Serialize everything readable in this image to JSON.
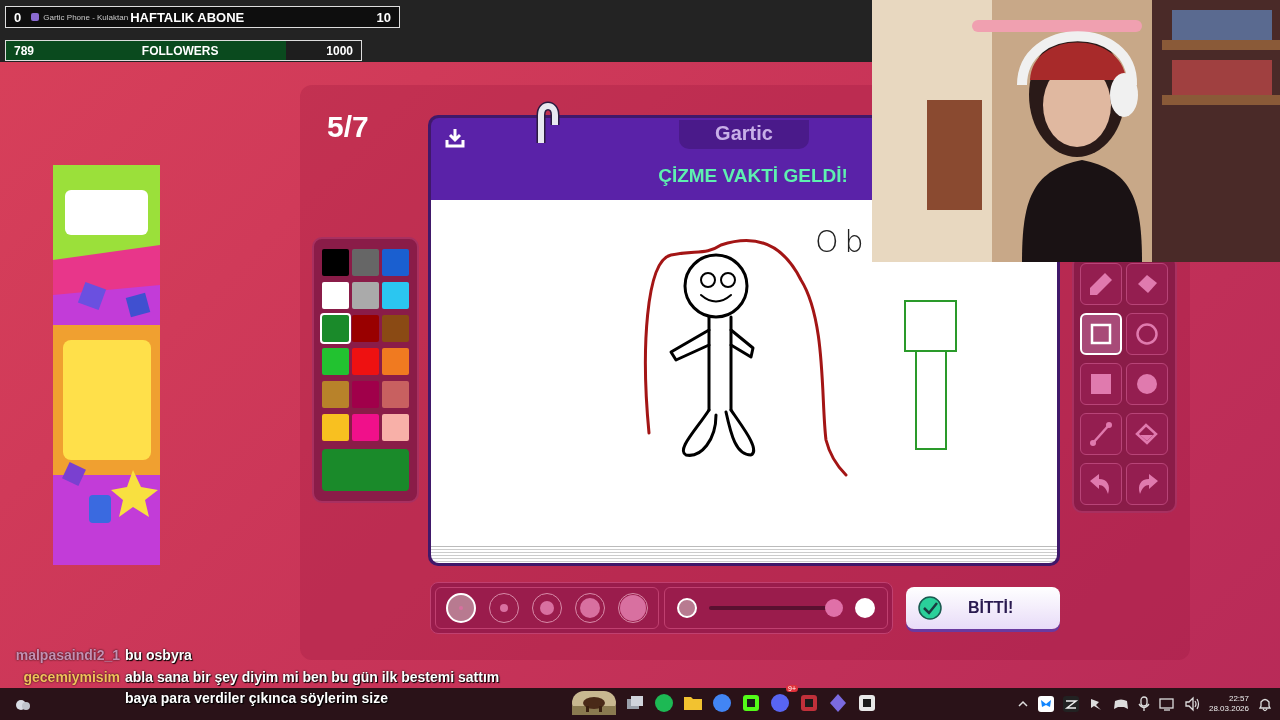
{
  "browser_tab": {
    "title": "Gartic Phone - Kulaktan"
  },
  "stream_overlay": {
    "subs_goal": {
      "current": "0",
      "title": "HAFTALIK ABONE",
      "target": "10"
    },
    "followers_goal": {
      "current": "789",
      "title": "FOLLOWERS",
      "target": "1000",
      "level": 0.789
    }
  },
  "game": {
    "round": "5/7",
    "logo": "Gartic",
    "heading": "ÇİZME VAKTİ GELDİ!",
    "canvas_text": "Ob",
    "palette": [
      {
        "color": "#000000",
        "selected": false
      },
      {
        "color": "#666666",
        "selected": false
      },
      {
        "color": "#1a5fd0",
        "selected": false
      },
      {
        "color": "#ffffff",
        "selected": false
      },
      {
        "color": "#aaaaaa",
        "selected": false
      },
      {
        "color": "#2bc6f0",
        "selected": false
      },
      {
        "color": "#1a8a2a",
        "selected": true
      },
      {
        "color": "#990000",
        "selected": false
      },
      {
        "color": "#8a4a14",
        "selected": false
      },
      {
        "color": "#22c230",
        "selected": false
      },
      {
        "color": "#ee1111",
        "selected": false
      },
      {
        "color": "#f07a20",
        "selected": false
      },
      {
        "color": "#b8822a",
        "selected": false
      },
      {
        "color": "#a0004a",
        "selected": false
      },
      {
        "color": "#c86060",
        "selected": false
      },
      {
        "color": "#f8c020",
        "selected": false
      },
      {
        "color": "#f0108a",
        "selected": false
      },
      {
        "color": "#f8b0a8",
        "selected": false
      }
    ],
    "tools": [
      {
        "kind": "pencil",
        "selected": false
      },
      {
        "kind": "eraser",
        "selected": false
      },
      {
        "kind": "rect",
        "selected": true
      },
      {
        "kind": "ellipse",
        "selected": false
      },
      {
        "kind": "rect_fill",
        "selected": false
      },
      {
        "kind": "ellipse_fill",
        "selected": false
      },
      {
        "kind": "line",
        "selected": false
      },
      {
        "kind": "bucket",
        "selected": false
      },
      {
        "kind": "undo",
        "selected": false
      },
      {
        "kind": "redo",
        "selected": false
      }
    ],
    "brush_sizes": [
      {
        "selected": true
      },
      {
        "selected": false
      },
      {
        "selected": false
      },
      {
        "selected": false
      },
      {
        "selected": false
      }
    ],
    "opacity": {
      "level": 1.0
    },
    "done_button": "BİTTİ!"
  },
  "chat": [
    {
      "user": "malpasaindi2_1",
      "color": "#c58fb2",
      "message": "bu osbyra"
    },
    {
      "user": "gecemiymisim",
      "color": "#f2c15a",
      "message": "abla sana bir şey diyim mi ben bu gün ilk bestemi sattım baya para verdiler çıkınca söylerim size"
    }
  ],
  "taskbar": {
    "apps": [
      {
        "kind": "thumbnail"
      },
      {
        "kind": "taskview"
      },
      {
        "kind": "spotify"
      },
      {
        "kind": "folder"
      },
      {
        "kind": "chrome"
      },
      {
        "kind": "kapp"
      },
      {
        "kind": "discord",
        "badge": "9+"
      },
      {
        "kind": "video"
      },
      {
        "kind": "prism"
      },
      {
        "kind": "capcut"
      }
    ],
    "time": "22:57",
    "date": "28.03.2026"
  }
}
